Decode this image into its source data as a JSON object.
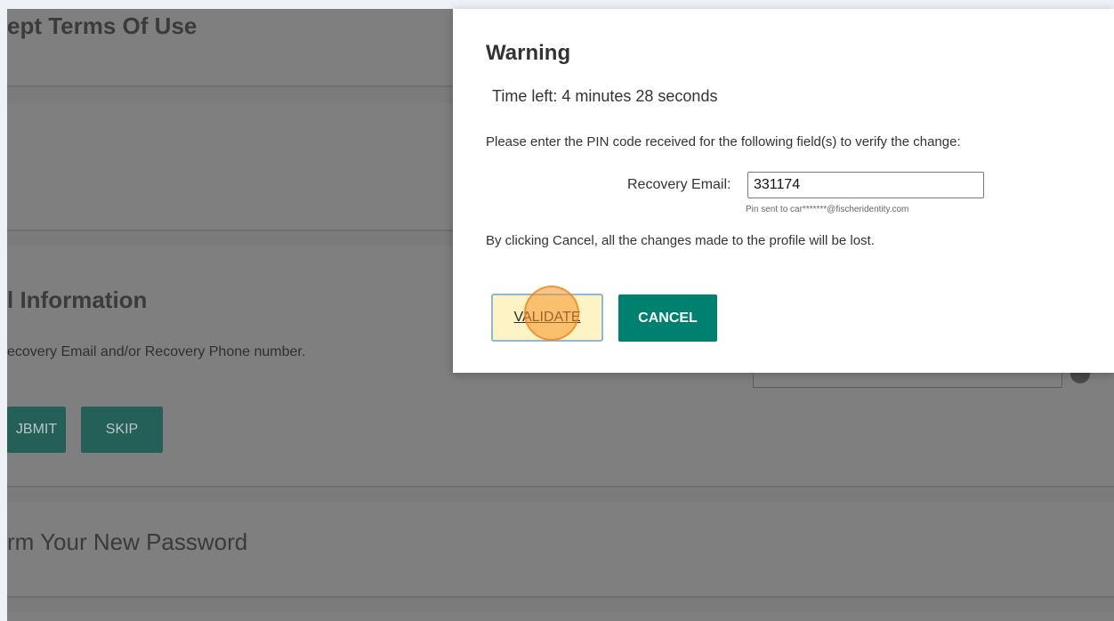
{
  "background": {
    "terms_title": "ept Terms Of Use",
    "info_title": "l Information",
    "info_text": "ecovery Email and/or Recovery Phone number.",
    "submit_label": "JBMIT",
    "skip_label": "SKIP",
    "confirm_title": "rm Your New Password"
  },
  "dialog": {
    "title": "Warning",
    "time_left": "Time left: 4 minutes 28 seconds",
    "instruction": "Please enter the PIN code received for the following field(s) to verify the change:",
    "field_label": "Recovery Email:",
    "pin_value": "331174",
    "pin_hint": "Pin sent to car*******@fischeridentity.com",
    "cancel_warning": "By clicking Cancel, all the changes made to the profile will be lost.",
    "validate_label": "VALIDATE",
    "cancel_label": "CANCEL"
  },
  "colors": {
    "overlay_gray": "#7b7b7b",
    "primary_teal": "#00806e",
    "validate_highlight": "#fdf3c4",
    "click_marker": "#f89628"
  },
  "icons": {
    "background_help": "help-circle-icon"
  }
}
